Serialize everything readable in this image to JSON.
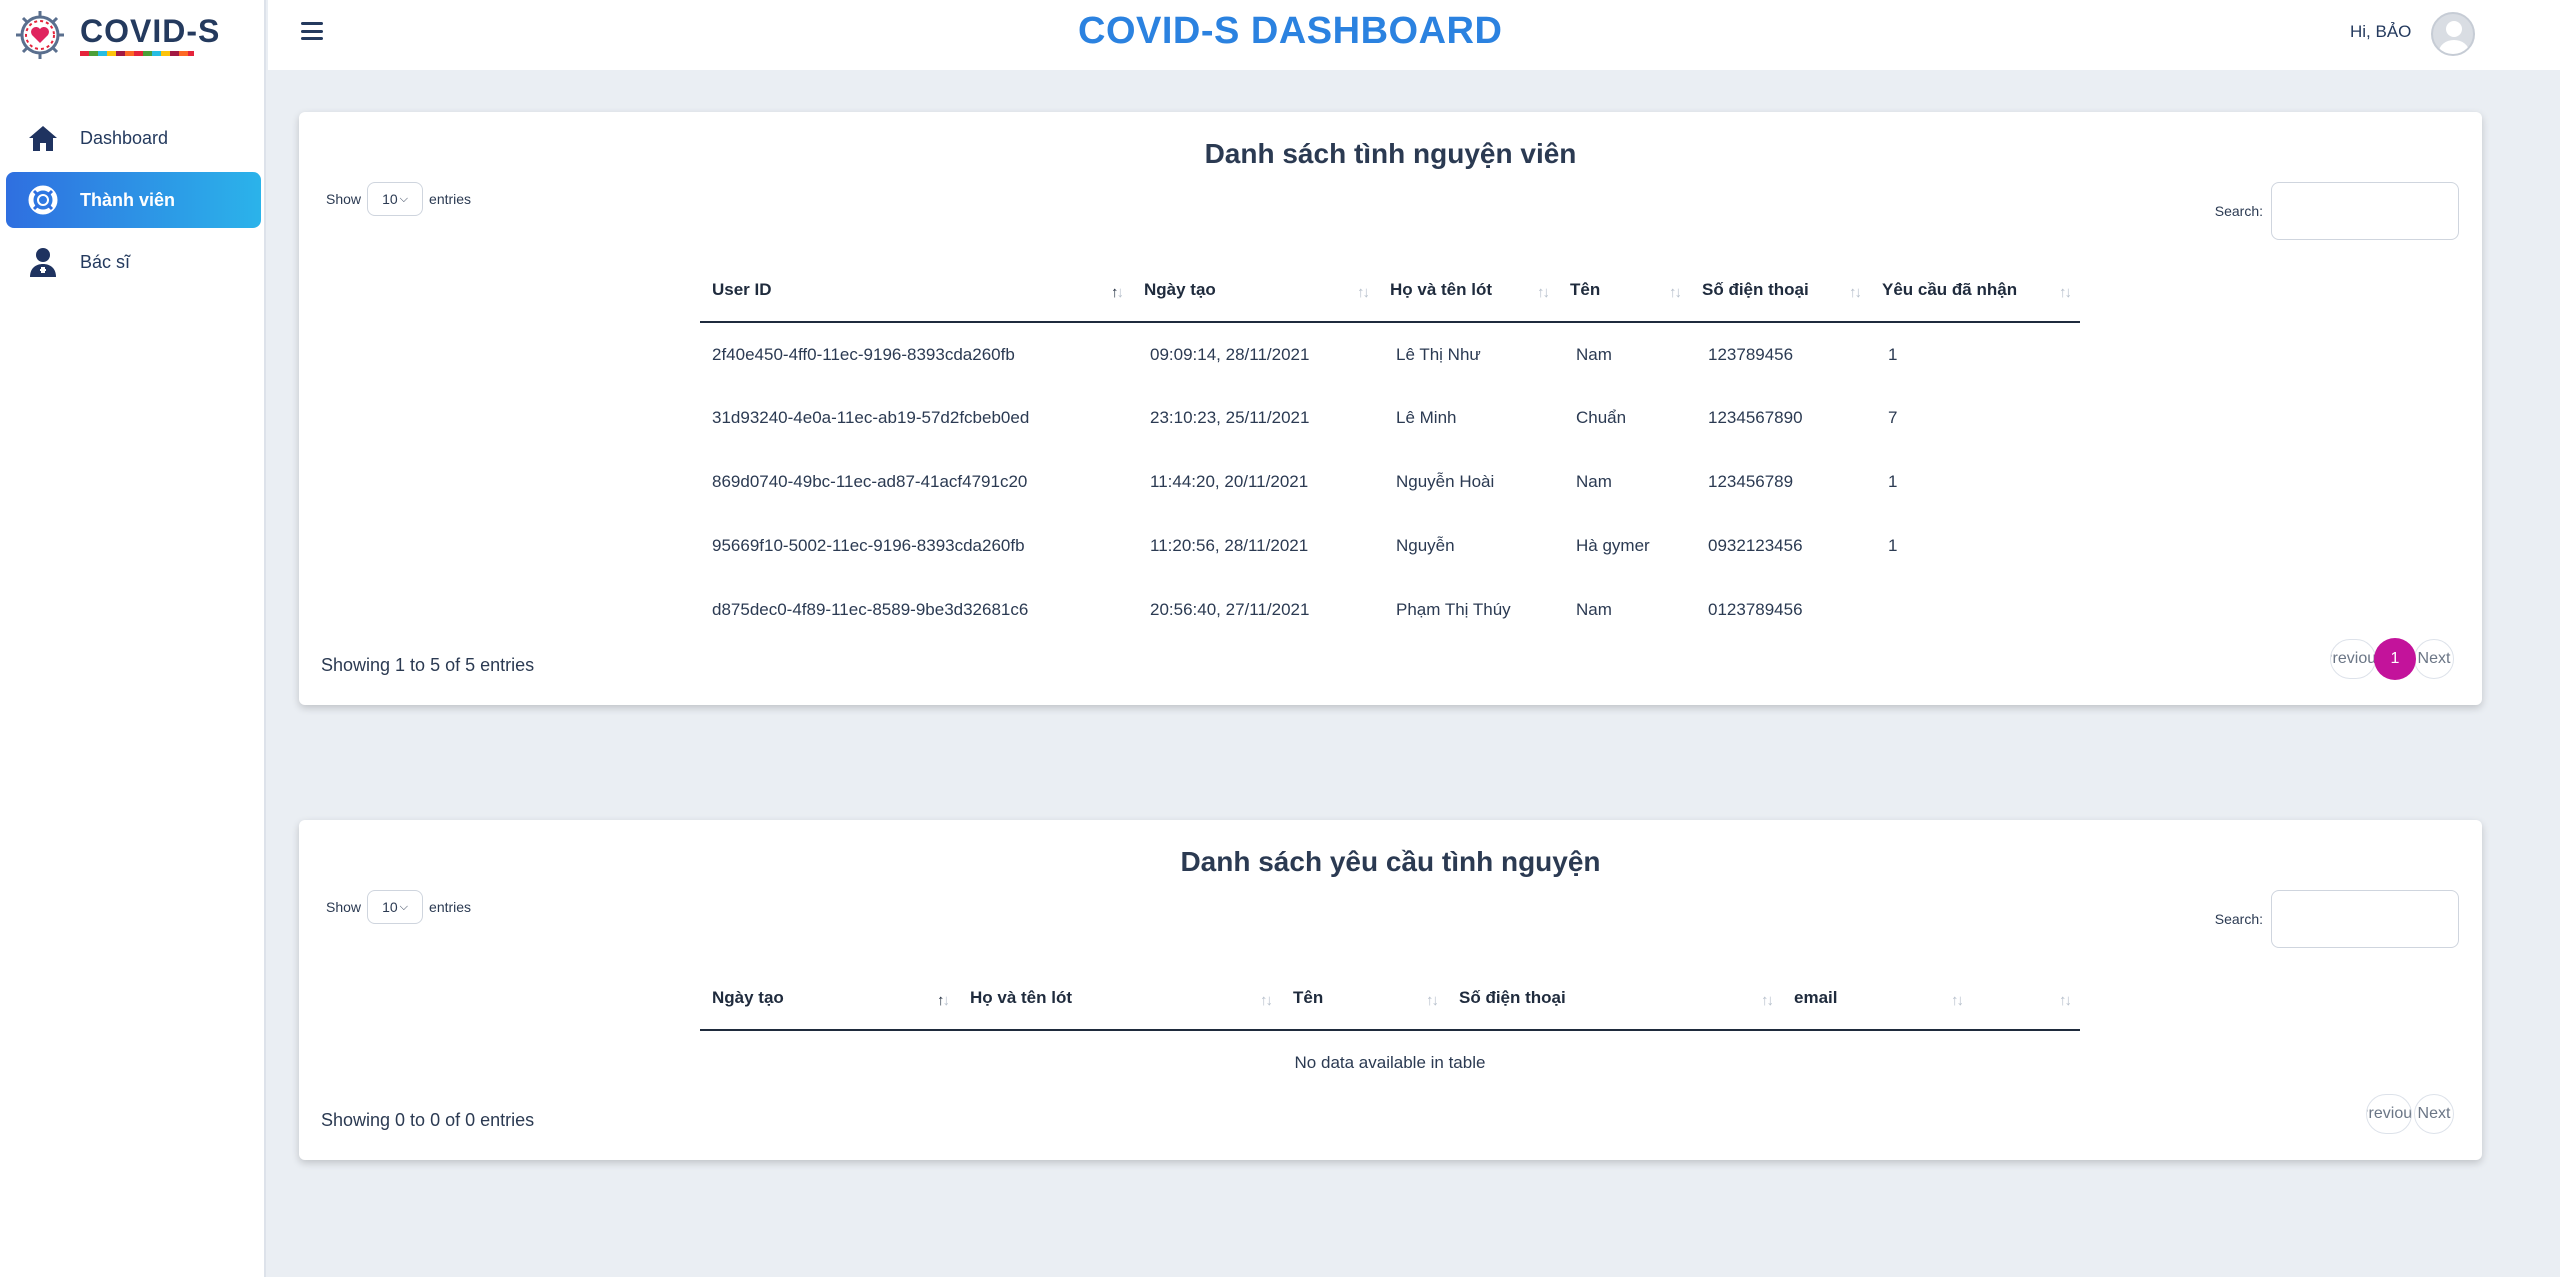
{
  "brand": {
    "name": "COVID-S",
    "logo_icon": "covid-virus-heart-logo"
  },
  "sidebar": {
    "items": [
      {
        "label": "Dashboard",
        "icon": "home-icon",
        "active": false
      },
      {
        "label": "Thành viên",
        "icon": "life-ring-icon",
        "active": true
      },
      {
        "label": "Bác sĩ",
        "icon": "doctor-icon",
        "active": false
      }
    ]
  },
  "header": {
    "title": "COVID-S DASHBOARD",
    "greeting": "Hi, BẢO"
  },
  "volunteers": {
    "title": "Danh sách tình nguyện viên",
    "length_show": "Show",
    "length_value": "10",
    "length_entries": "entries",
    "search_label": "Search:",
    "columns": [
      "User ID",
      "Ngày tạo",
      "Họ và tên lót",
      "Tên",
      "Số điện thoại",
      "Yêu cầu đã nhận"
    ],
    "rows": [
      [
        "2f40e450-4ff0-11ec-9196-8393cda260fb",
        "09:09:14, 28/11/2021",
        "Lê Thị Như",
        "Nam",
        "123789456",
        "1"
      ],
      [
        "31d93240-4e0a-11ec-ab19-57d2fcbeb0ed",
        "23:10:23, 25/11/2021",
        "Lê Minh",
        "Chuẩn",
        "1234567890",
        "7"
      ],
      [
        "869d0740-49bc-11ec-ad87-41acf4791c20",
        "11:44:20, 20/11/2021",
        "Nguyễn Hoài",
        "Nam",
        "123456789",
        "1"
      ],
      [
        "95669f10-5002-11ec-9196-8393cda260fb",
        "11:20:56, 28/11/2021",
        "Nguyễn",
        "Hà gymer",
        "0932123456",
        "1"
      ],
      [
        "d875dec0-4f89-11ec-8589-9be3d32681c6",
        "20:56:40, 27/11/2021",
        "Phạm Thị Thúy",
        "Nam",
        "0123789456",
        ""
      ]
    ],
    "info": "Showing 1 to 5 of 5 entries",
    "pager": {
      "prev": "Previous",
      "current": "1",
      "next": "Next"
    }
  },
  "requests": {
    "title": "Danh sách yêu cầu tình nguyện",
    "length_show": "Show",
    "length_value": "10",
    "length_entries": "entries",
    "search_label": "Search:",
    "columns": [
      "Ngày tạo",
      "Họ và tên lót",
      "Tên",
      "Số điện thoại",
      "email",
      ""
    ],
    "empty": "No data available in table",
    "info": "Showing 0 to 0 of 0 entries",
    "pager": {
      "prev": "Previous",
      "next": "Next"
    }
  },
  "colors": {
    "accent": "#2b82e0",
    "active_page": "#c3139b",
    "nav_active_start": "#2f6fe0",
    "nav_active_end": "#2bb3ea"
  }
}
